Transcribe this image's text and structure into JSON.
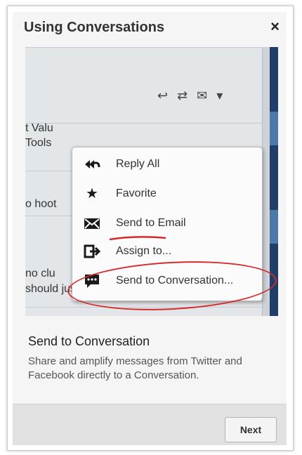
{
  "dialog": {
    "title": "Using Conversations",
    "close_label": "×",
    "heading": "Send to Conversation",
    "description": "Share and amplify messages from Twitter and Facebook directly to a Conversation.",
    "next_label": "Next"
  },
  "screenshot": {
    "toolbar_icons": "↩ ⇄ ✉ ▾",
    "bg_text_1": "t Valu",
    "bg_text_2": " Tools",
    "bg_text_3": "o hoot",
    "bg_text_4": "no clu",
    "bg_text_5": "should just meet up for the lon party.",
    "menu": [
      {
        "label": "Reply All",
        "icon": "reply-all-icon"
      },
      {
        "label": "Favorite",
        "icon": "star-icon"
      },
      {
        "label": "Send to Email",
        "icon": "envelope-icon"
      },
      {
        "label": "Assign to...",
        "icon": "assign-icon"
      },
      {
        "label": "Send to Conversation...",
        "icon": "chat-bubble-icon"
      }
    ]
  },
  "colors": {
    "annotation": "#d62a2a",
    "accent_blue": "#1f3f6a"
  }
}
